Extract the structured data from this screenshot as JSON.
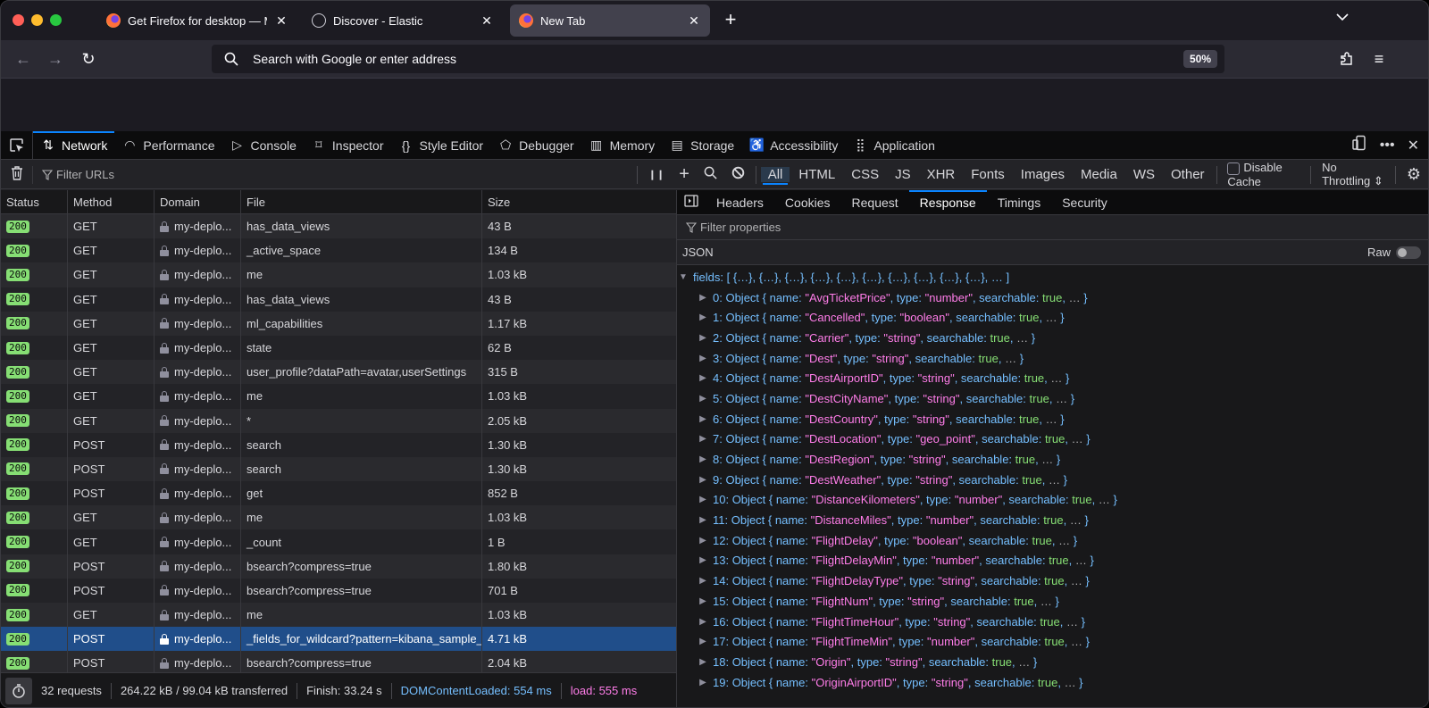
{
  "browser": {
    "tabs": [
      {
        "title": "Get Firefox for desktop — Mozilla",
        "icon": "firefox-icon",
        "active": false
      },
      {
        "title": "Discover - Elastic",
        "icon": "elastic-icon",
        "active": false
      },
      {
        "title": "New Tab",
        "icon": "firefox-icon",
        "active": true
      }
    ],
    "close_glyph": "✕",
    "new_tab_glyph": "+",
    "list_tabs_glyph": "⌄",
    "nav": {
      "back": "←",
      "forward": "→",
      "reload": "↻"
    },
    "url_placeholder": "Search with Google or enter address",
    "zoom_level": "50%",
    "extensions_glyph": "⧉",
    "menu_glyph": "≡"
  },
  "devtools": {
    "tools": [
      {
        "label": "Network",
        "icon": "⇅",
        "active": true
      },
      {
        "label": "Performance",
        "icon": "◠",
        "active": false
      },
      {
        "label": "Console",
        "icon": "▷",
        "active": false
      },
      {
        "label": "Inspector",
        "icon": "⌑",
        "active": false
      },
      {
        "label": "Style Editor",
        "icon": "{}",
        "active": false
      },
      {
        "label": "Debugger",
        "icon": "⬠",
        "active": false
      },
      {
        "label": "Memory",
        "icon": "▥",
        "active": false
      },
      {
        "label": "Storage",
        "icon": "▤",
        "active": false
      },
      {
        "label": "Accessibility",
        "icon": "♿",
        "active": false
      },
      {
        "label": "Application",
        "icon": "⣿",
        "active": false
      }
    ],
    "toolbar": {
      "filter_placeholder": "Filter URLs",
      "pause": "❙❙",
      "add": "+",
      "search": "⌕",
      "block": "⊘",
      "type_filters": [
        "All",
        "HTML",
        "CSS",
        "JS",
        "XHR",
        "Fonts",
        "Images",
        "Media",
        "WS",
        "Other"
      ],
      "active_filter": "All",
      "disable_cache_label": "Disable Cache",
      "disable_cache_checked": false,
      "throttling": "No Throttling ⇕",
      "settings": "⚙"
    },
    "table": {
      "columns": [
        "Status",
        "Method",
        "Domain",
        "File",
        "Size"
      ],
      "rows": [
        {
          "status": "200",
          "method": "GET",
          "domain": "my-deplo...",
          "file": "has_data_views",
          "size": "43 B"
        },
        {
          "status": "200",
          "method": "GET",
          "domain": "my-deplo...",
          "file": "_active_space",
          "size": "134 B"
        },
        {
          "status": "200",
          "method": "GET",
          "domain": "my-deplo...",
          "file": "me",
          "size": "1.03 kB"
        },
        {
          "status": "200",
          "method": "GET",
          "domain": "my-deplo...",
          "file": "has_data_views",
          "size": "43 B"
        },
        {
          "status": "200",
          "method": "GET",
          "domain": "my-deplo...",
          "file": "ml_capabilities",
          "size": "1.17 kB"
        },
        {
          "status": "200",
          "method": "GET",
          "domain": "my-deplo...",
          "file": "state",
          "size": "62 B"
        },
        {
          "status": "200",
          "method": "GET",
          "domain": "my-deplo...",
          "file": "user_profile?dataPath=avatar,userSettings",
          "size": "315 B"
        },
        {
          "status": "200",
          "method": "GET",
          "domain": "my-deplo...",
          "file": "me",
          "size": "1.03 kB"
        },
        {
          "status": "200",
          "method": "GET",
          "domain": "my-deplo...",
          "file": "*",
          "size": "2.05 kB"
        },
        {
          "status": "200",
          "method": "POST",
          "domain": "my-deplo...",
          "file": "search",
          "size": "1.30 kB"
        },
        {
          "status": "200",
          "method": "POST",
          "domain": "my-deplo...",
          "file": "search",
          "size": "1.30 kB"
        },
        {
          "status": "200",
          "method": "POST",
          "domain": "my-deplo...",
          "file": "get",
          "size": "852 B"
        },
        {
          "status": "200",
          "method": "GET",
          "domain": "my-deplo...",
          "file": "me",
          "size": "1.03 kB"
        },
        {
          "status": "200",
          "method": "GET",
          "domain": "my-deplo...",
          "file": "_count",
          "size": "1 B"
        },
        {
          "status": "200",
          "method": "POST",
          "domain": "my-deplo...",
          "file": "bsearch?compress=true",
          "size": "1.80 kB"
        },
        {
          "status": "200",
          "method": "POST",
          "domain": "my-deplo...",
          "file": "bsearch?compress=true",
          "size": "701 B"
        },
        {
          "status": "200",
          "method": "GET",
          "domain": "my-deplo...",
          "file": "me",
          "size": "1.03 kB"
        },
        {
          "status": "200",
          "method": "POST",
          "domain": "my-deplo...",
          "file": "_fields_for_wildcard?pattern=kibana_sample_data_flights",
          "size": "4.71 kB",
          "selected": true
        },
        {
          "status": "200",
          "method": "POST",
          "domain": "my-deplo...",
          "file": "bsearch?compress=true",
          "size": "2.04 kB"
        }
      ]
    },
    "summary": {
      "requests": "32 requests",
      "transferred": "264.22 kB / 99.04 kB transferred",
      "finish": "Finish: 33.24 s",
      "dom_content_loaded": "DOMContentLoaded: 554 ms",
      "load": "load: 555 ms"
    },
    "details": {
      "tabs": [
        "Headers",
        "Cookies",
        "Request",
        "Response",
        "Timings",
        "Security"
      ],
      "active_tab": "Response",
      "filter_placeholder": "Filter properties",
      "section_label": "JSON",
      "raw_label": "Raw",
      "raw_enabled": false,
      "root_key": "fields",
      "root_summary": "[ {…}, {…}, {…}, {…}, {…}, {…}, {…}, {…}, {…}, {…}, … ]",
      "fields": [
        {
          "index": "0",
          "name": "AvgTicketPrice",
          "type": "number"
        },
        {
          "index": "1",
          "name": "Cancelled",
          "type": "boolean"
        },
        {
          "index": "2",
          "name": "Carrier",
          "type": "string"
        },
        {
          "index": "3",
          "name": "Dest",
          "type": "string"
        },
        {
          "index": "4",
          "name": "DestAirportID",
          "type": "string"
        },
        {
          "index": "5",
          "name": "DestCityName",
          "type": "string"
        },
        {
          "index": "6",
          "name": "DestCountry",
          "type": "string"
        },
        {
          "index": "7",
          "name": "DestLocation",
          "type": "geo_point"
        },
        {
          "index": "8",
          "name": "DestRegion",
          "type": "string"
        },
        {
          "index": "9",
          "name": "DestWeather",
          "type": "string"
        },
        {
          "index": "10",
          "name": "DistanceKilometers",
          "type": "number"
        },
        {
          "index": "11",
          "name": "DistanceMiles",
          "type": "number"
        },
        {
          "index": "12",
          "name": "FlightDelay",
          "type": "boolean"
        },
        {
          "index": "13",
          "name": "FlightDelayMin",
          "type": "number"
        },
        {
          "index": "14",
          "name": "FlightDelayType",
          "type": "string"
        },
        {
          "index": "15",
          "name": "FlightNum",
          "type": "string"
        },
        {
          "index": "16",
          "name": "FlightTimeHour",
          "type": "string"
        },
        {
          "index": "17",
          "name": "FlightTimeMin",
          "type": "number"
        },
        {
          "index": "18",
          "name": "Origin",
          "type": "string"
        },
        {
          "index": "19",
          "name": "OriginAirportID",
          "type": "string"
        }
      ],
      "searchable_value": "true"
    }
  }
}
